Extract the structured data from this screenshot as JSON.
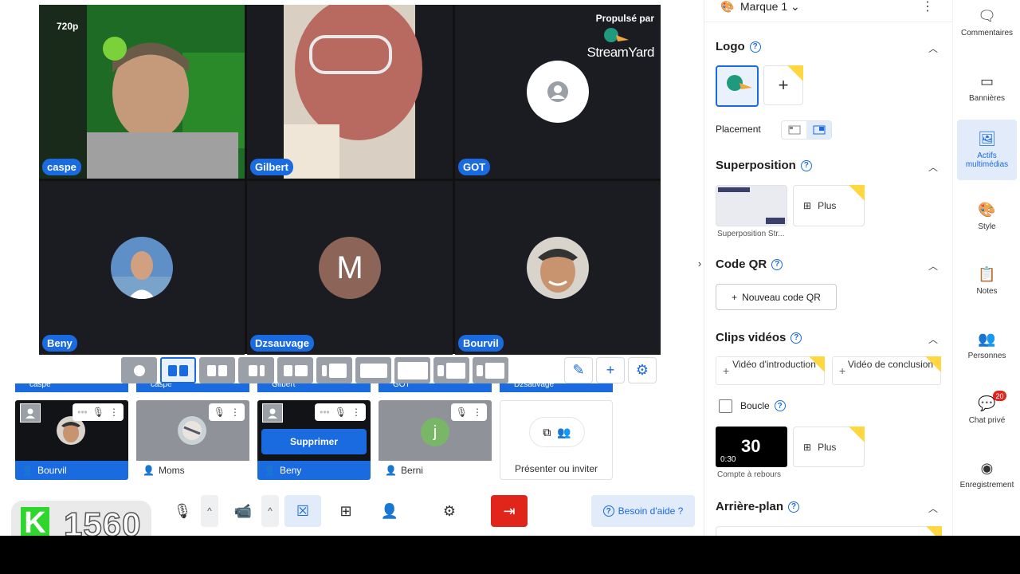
{
  "stage": {
    "resolution": "720p",
    "branding": {
      "powered": "Propulsé par",
      "name": "StreamYard"
    },
    "participants": [
      "caspe",
      "Gilbert",
      "GOT",
      "Beny",
      "Dzsauvage",
      "Bourvil"
    ],
    "dz_initial": "M"
  },
  "backstage": {
    "strip": [
      "caspe",
      "caspe",
      "Gilbert",
      "GOT",
      "Dzsauvage"
    ],
    "cards": [
      "Bourvil",
      "Moms",
      "Beny",
      "Berni"
    ],
    "berni_initial": "j",
    "remove_label": "Supprimer",
    "invite_label": "Présenter ou inviter"
  },
  "badge": {
    "letter": "K",
    "count": "1560"
  },
  "toolbar": {
    "help": "Besoin d'aide ?"
  },
  "panel": {
    "brand": "Marque 1",
    "logo": "Logo",
    "placement": "Placement",
    "overlay": "Superposition",
    "overlay_thumb": "Superposition Str...",
    "more": "Plus",
    "qr": "Code QR",
    "qr_btn": "Nouveau code QR",
    "clips": "Clips vidéos",
    "clip_intro": "Vidéo d'introduction",
    "clip_outro": "Vidéo de conclusion",
    "loop": "Boucle",
    "countdown_big": "30",
    "countdown_small": "0:30",
    "countdown_label": "Compte à rebours",
    "background": "Arrière-plan"
  },
  "nav": {
    "comments": "Commentaires",
    "banners": "Bannières",
    "assets": "Actifs multimédias",
    "style": "Style",
    "notes": "Notes",
    "people": "Personnes",
    "chat": "Chat privé",
    "chat_count": "20",
    "record": "Enregistrement"
  },
  "colors": {
    "accent": "#1a6ae0",
    "danger": "#e0251b",
    "badge_green": "#2fd62b"
  }
}
